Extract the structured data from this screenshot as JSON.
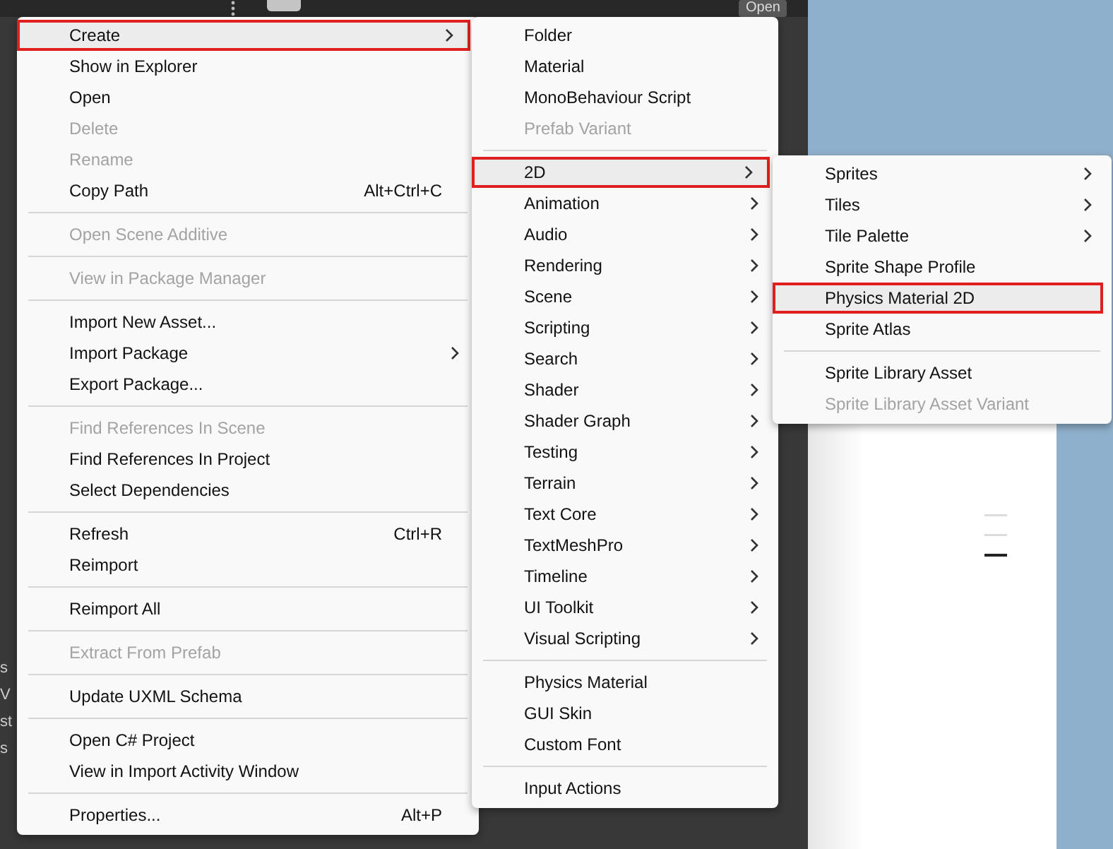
{
  "editor": {
    "open_button": "Open",
    "side_texts": [
      "s",
      "V",
      "st",
      "s"
    ]
  },
  "menus": [
    {
      "items": [
        {
          "kind": "item",
          "label": "Create",
          "submenu": true,
          "disabled": false,
          "selected": true
        },
        {
          "kind": "item",
          "label": "Show in Explorer",
          "submenu": false,
          "disabled": false,
          "selected": false
        },
        {
          "kind": "item",
          "label": "Open",
          "submenu": false,
          "disabled": false,
          "selected": false
        },
        {
          "kind": "item",
          "label": "Delete",
          "submenu": false,
          "disabled": true,
          "selected": false
        },
        {
          "kind": "item",
          "label": "Rename",
          "submenu": false,
          "disabled": true,
          "selected": false
        },
        {
          "kind": "item",
          "label": "Copy Path",
          "shortcut": "Alt+Ctrl+C",
          "submenu": false,
          "disabled": false,
          "selected": false
        },
        {
          "kind": "separator"
        },
        {
          "kind": "item",
          "label": "Open Scene Additive",
          "submenu": false,
          "disabled": true,
          "selected": false
        },
        {
          "kind": "separator"
        },
        {
          "kind": "item",
          "label": "View in Package Manager",
          "submenu": false,
          "disabled": true,
          "selected": false
        },
        {
          "kind": "separator"
        },
        {
          "kind": "item",
          "label": "Import New Asset...",
          "submenu": false,
          "disabled": false,
          "selected": false
        },
        {
          "kind": "item",
          "label": "Import Package",
          "submenu": true,
          "disabled": false,
          "selected": false
        },
        {
          "kind": "item",
          "label": "Export Package...",
          "submenu": false,
          "disabled": false,
          "selected": false
        },
        {
          "kind": "separator"
        },
        {
          "kind": "item",
          "label": "Find References In Scene",
          "submenu": false,
          "disabled": true,
          "selected": false
        },
        {
          "kind": "item",
          "label": "Find References In Project",
          "submenu": false,
          "disabled": false,
          "selected": false
        },
        {
          "kind": "item",
          "label": "Select Dependencies",
          "submenu": false,
          "disabled": false,
          "selected": false
        },
        {
          "kind": "separator"
        },
        {
          "kind": "item",
          "label": "Refresh",
          "shortcut": "Ctrl+R",
          "submenu": false,
          "disabled": false,
          "selected": false
        },
        {
          "kind": "item",
          "label": "Reimport",
          "submenu": false,
          "disabled": false,
          "selected": false
        },
        {
          "kind": "separator"
        },
        {
          "kind": "item",
          "label": "Reimport All",
          "submenu": false,
          "disabled": false,
          "selected": false
        },
        {
          "kind": "separator"
        },
        {
          "kind": "item",
          "label": "Extract From Prefab",
          "submenu": false,
          "disabled": true,
          "selected": false
        },
        {
          "kind": "separator"
        },
        {
          "kind": "item",
          "label": "Update UXML Schema",
          "submenu": false,
          "disabled": false,
          "selected": false
        },
        {
          "kind": "separator"
        },
        {
          "kind": "item",
          "label": "Open C# Project",
          "submenu": false,
          "disabled": false,
          "selected": false
        },
        {
          "kind": "item",
          "label": "View in Import Activity Window",
          "submenu": false,
          "disabled": false,
          "selected": false
        },
        {
          "kind": "separator"
        },
        {
          "kind": "item",
          "label": "Properties...",
          "shortcut": "Alt+P",
          "submenu": false,
          "disabled": false,
          "selected": false
        }
      ]
    },
    {
      "items": [
        {
          "kind": "item",
          "label": "Folder",
          "submenu": false,
          "disabled": false,
          "selected": false
        },
        {
          "kind": "item",
          "label": "Material",
          "submenu": false,
          "disabled": false,
          "selected": false
        },
        {
          "kind": "item",
          "label": "MonoBehaviour Script",
          "submenu": false,
          "disabled": false,
          "selected": false
        },
        {
          "kind": "item",
          "label": "Prefab Variant",
          "submenu": false,
          "disabled": true,
          "selected": false
        },
        {
          "kind": "separator"
        },
        {
          "kind": "item",
          "label": "2D",
          "submenu": true,
          "disabled": false,
          "selected": true
        },
        {
          "kind": "item",
          "label": "Animation",
          "submenu": true,
          "disabled": false,
          "selected": false
        },
        {
          "kind": "item",
          "label": "Audio",
          "submenu": true,
          "disabled": false,
          "selected": false
        },
        {
          "kind": "item",
          "label": "Rendering",
          "submenu": true,
          "disabled": false,
          "selected": false
        },
        {
          "kind": "item",
          "label": "Scene",
          "submenu": true,
          "disabled": false,
          "selected": false
        },
        {
          "kind": "item",
          "label": "Scripting",
          "submenu": true,
          "disabled": false,
          "selected": false
        },
        {
          "kind": "item",
          "label": "Search",
          "submenu": true,
          "disabled": false,
          "selected": false
        },
        {
          "kind": "item",
          "label": "Shader",
          "submenu": true,
          "disabled": false,
          "selected": false
        },
        {
          "kind": "item",
          "label": "Shader Graph",
          "submenu": true,
          "disabled": false,
          "selected": false
        },
        {
          "kind": "item",
          "label": "Testing",
          "submenu": true,
          "disabled": false,
          "selected": false
        },
        {
          "kind": "item",
          "label": "Terrain",
          "submenu": true,
          "disabled": false,
          "selected": false
        },
        {
          "kind": "item",
          "label": "Text Core",
          "submenu": true,
          "disabled": false,
          "selected": false
        },
        {
          "kind": "item",
          "label": "TextMeshPro",
          "submenu": true,
          "disabled": false,
          "selected": false
        },
        {
          "kind": "item",
          "label": "Timeline",
          "submenu": true,
          "disabled": false,
          "selected": false
        },
        {
          "kind": "item",
          "label": "UI Toolkit",
          "submenu": true,
          "disabled": false,
          "selected": false
        },
        {
          "kind": "item",
          "label": "Visual Scripting",
          "submenu": true,
          "disabled": false,
          "selected": false
        },
        {
          "kind": "separator"
        },
        {
          "kind": "item",
          "label": "Physics Material",
          "submenu": false,
          "disabled": false,
          "selected": false
        },
        {
          "kind": "item",
          "label": "GUI Skin",
          "submenu": false,
          "disabled": false,
          "selected": false
        },
        {
          "kind": "item",
          "label": "Custom Font",
          "submenu": false,
          "disabled": false,
          "selected": false
        },
        {
          "kind": "separator"
        },
        {
          "kind": "item",
          "label": "Input Actions",
          "submenu": false,
          "disabled": false,
          "selected": false
        }
      ]
    },
    {
      "items": [
        {
          "kind": "item",
          "label": "Sprites",
          "submenu": true,
          "disabled": false,
          "selected": false
        },
        {
          "kind": "item",
          "label": "Tiles",
          "submenu": true,
          "disabled": false,
          "selected": false
        },
        {
          "kind": "item",
          "label": "Tile Palette",
          "submenu": true,
          "disabled": false,
          "selected": false
        },
        {
          "kind": "item",
          "label": "Sprite Shape Profile",
          "submenu": false,
          "disabled": false,
          "selected": false
        },
        {
          "kind": "item",
          "label": "Physics Material 2D",
          "submenu": false,
          "disabled": false,
          "selected": true
        },
        {
          "kind": "item",
          "label": "Sprite Atlas",
          "submenu": false,
          "disabled": false,
          "selected": false
        },
        {
          "kind": "separator"
        },
        {
          "kind": "item",
          "label": "Sprite Library Asset",
          "submenu": false,
          "disabled": false,
          "selected": false
        },
        {
          "kind": "item",
          "label": "Sprite Library Asset Variant",
          "submenu": false,
          "disabled": true,
          "selected": false
        }
      ]
    }
  ]
}
